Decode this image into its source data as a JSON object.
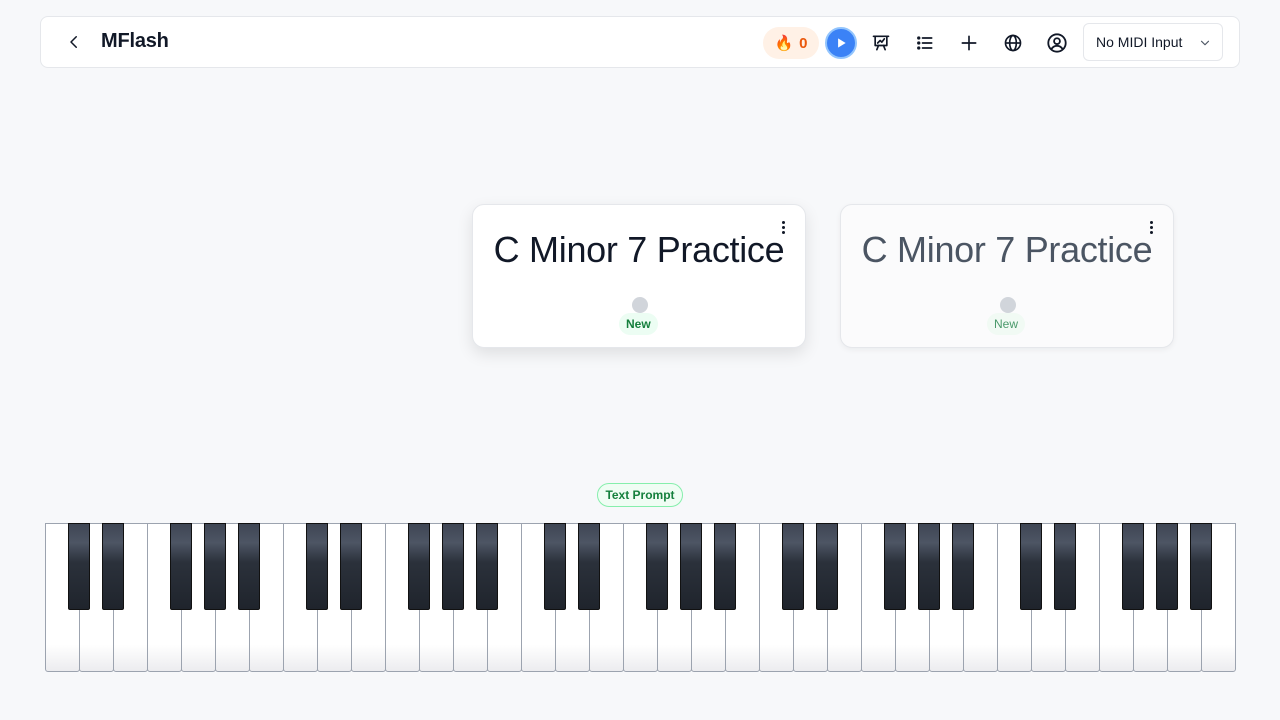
{
  "header": {
    "title": "MFlash",
    "streak_icon": "🔥",
    "streak_count": "0",
    "midi_input": "No MIDI Input",
    "icons": [
      "back-icon",
      "play-icon",
      "chart-icon",
      "list-icon",
      "plus-icon",
      "globe-icon",
      "user-circle-icon",
      "chevron-down-icon"
    ]
  },
  "cards": [
    {
      "title": "C Minor 7 Practice",
      "status": "New"
    },
    {
      "title": "C Minor 7 Practice",
      "status": "New"
    }
  ],
  "prompt": {
    "label": "Text Prompt"
  },
  "keyboard": {
    "white_keys": 35,
    "octaves": 5
  },
  "colors": {
    "accent": "#3b82f6",
    "streak": "#ea580c",
    "badge_green": "#15803d",
    "background": "#f7f8fa"
  }
}
